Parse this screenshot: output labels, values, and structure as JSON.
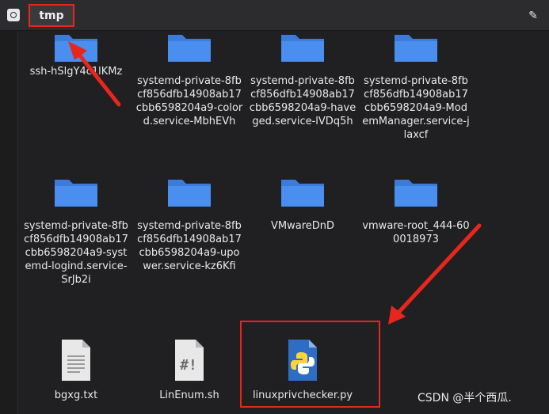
{
  "toolbar": {
    "path_label": "tmp",
    "drive_icon": "drive-icon",
    "edit_icon": "pencil-icon"
  },
  "items": [
    {
      "label": "ssh-hSlgY4c1lKMz",
      "type": "folder"
    },
    {
      "label": "systemd-private-8fbcf856dfb14908ab17cbb6598204a9-colord.service-MbhEVh",
      "type": "folder"
    },
    {
      "label": "systemd-private-8fbcf856dfb14908ab17cbb6598204a9-haveged.service-lVDq5h",
      "type": "folder"
    },
    {
      "label": "systemd-private-8fbcf856dfb14908ab17cbb6598204a9-ModemManager.service-jlaxcf",
      "type": "folder"
    },
    {
      "label": "systemd-private-8fbcf856dfb14908ab17cbb6598204a9-systemd-logind.service-SrJb2i",
      "type": "folder"
    },
    {
      "label": "systemd-private-8fbcf856dfb14908ab17cbb6598204a9-upower.service-kz6Kfi",
      "type": "folder"
    },
    {
      "label": "VMwareDnD",
      "type": "folder"
    },
    {
      "label": "vmware-root_444-600018973",
      "type": "folder"
    },
    {
      "label": "bgxg.txt",
      "type": "text-file"
    },
    {
      "label": "LinEnum.sh",
      "type": "script-file"
    },
    {
      "label": "linuxprivchecker.py",
      "type": "python-file"
    }
  ],
  "watermark": "CSDN @半个西瓜.",
  "colors": {
    "folder": "#3d7bdb",
    "annotation": "#e8261c"
  }
}
